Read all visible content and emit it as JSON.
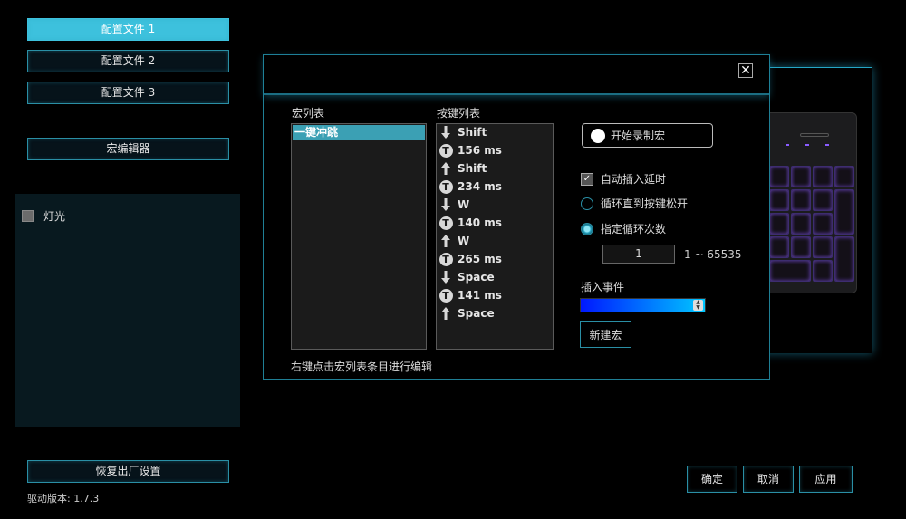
{
  "sidebar": {
    "profiles": [
      "配置文件 1",
      "配置文件 2",
      "配置文件 3"
    ],
    "macro_editor": "宏编辑器",
    "lighting_label": "灯光",
    "factory_reset": "恢复出厂设置",
    "driver_version": "驱动版本: 1.7.3"
  },
  "dialog": {
    "close_symbol": "✕",
    "macro_list_label": "宏列表",
    "macro_list": [
      "一键冲跳"
    ],
    "key_list_label": "按键列表",
    "key_list": [
      {
        "icon": "arrow-down-icon",
        "text": "Shift"
      },
      {
        "icon": "delay-t-icon",
        "text": "156 ms"
      },
      {
        "icon": "arrow-up-icon",
        "text": "Shift"
      },
      {
        "icon": "delay-t-icon",
        "text": "234 ms"
      },
      {
        "icon": "arrow-down-icon",
        "text": "W"
      },
      {
        "icon": "delay-t-icon",
        "text": "140 ms"
      },
      {
        "icon": "arrow-up-icon",
        "text": "W"
      },
      {
        "icon": "delay-t-icon",
        "text": "265 ms"
      },
      {
        "icon": "arrow-down-icon",
        "text": "Space"
      },
      {
        "icon": "delay-t-icon",
        "text": "141 ms"
      },
      {
        "icon": "arrow-up-icon",
        "text": "Space"
      }
    ],
    "record_button": "开始录制宏",
    "auto_delay_label": "自动插入延时",
    "auto_delay_checked": true,
    "loop_until_release_label": "循环直到按键松开",
    "loop_count_label": "指定循环次数",
    "loop_count_selected": true,
    "loop_count_value": "1",
    "loop_range": "1 ~ 65535",
    "insert_event_label": "插入事件",
    "new_macro_button": "新建宏",
    "hint": "右键点击宏列表条目进行编辑"
  },
  "footer": {
    "ok": "确定",
    "cancel": "取消",
    "apply": "应用"
  },
  "colors": {
    "accent": "#3dc1dd",
    "border": "#2a8fa5",
    "selection": "#3ba0b4"
  }
}
